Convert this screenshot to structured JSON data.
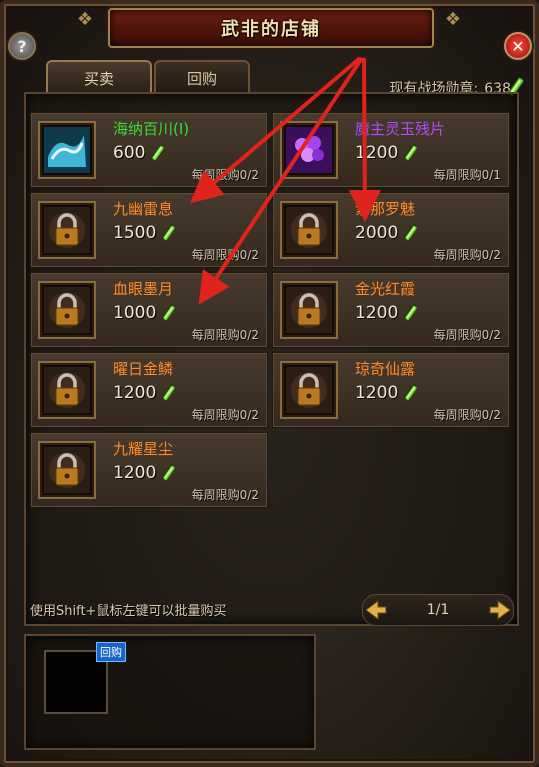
{
  "window": {
    "title": "武非的店铺",
    "help_label": "?",
    "close_label": "✕"
  },
  "tabs": [
    {
      "label": "买卖",
      "active": true
    },
    {
      "label": "回购",
      "active": false
    }
  ],
  "medal": {
    "label": "现有战场勋章:",
    "count": "638",
    "icon": "medal-icon"
  },
  "items": [
    {
      "name": "海纳百川(I)",
      "name_color": "#3fd93a",
      "price": "600",
      "limit": "每周限购0/2",
      "icon": "water-wave-icon",
      "locked": false
    },
    {
      "name": "魔主灵玉残片",
      "name_color": "#b24bff",
      "price": "1200",
      "limit": "每周限购0/1",
      "icon": "purple-jade-icon",
      "locked": false
    },
    {
      "name": "九幽雷息",
      "name_color": "#ff8a2a",
      "price": "1500",
      "limit": "每周限购0/2",
      "icon": "lock-icon",
      "locked": true
    },
    {
      "name": "紫那罗魅",
      "name_color": "#ff8a2a",
      "price": "2000",
      "limit": "每周限购0/2",
      "icon": "lock-icon",
      "locked": true
    },
    {
      "name": "血眼墨月",
      "name_color": "#ff8a2a",
      "price": "1000",
      "limit": "每周限购0/2",
      "icon": "lock-icon",
      "locked": true
    },
    {
      "name": "金光红霞",
      "name_color": "#ff8a2a",
      "price": "1200",
      "limit": "每周限购0/2",
      "icon": "lock-icon",
      "locked": true
    },
    {
      "name": "曜日金鳞",
      "name_color": "#ff8a2a",
      "price": "1200",
      "limit": "每周限购0/2",
      "icon": "lock-icon",
      "locked": true
    },
    {
      "name": "琼奇仙露",
      "name_color": "#ff8a2a",
      "price": "1200",
      "limit": "每周限购0/2",
      "icon": "lock-icon",
      "locked": true
    },
    {
      "name": "九耀星尘",
      "name_color": "#ff8a2a",
      "price": "1200",
      "limit": "每周限购0/2",
      "icon": "lock-icon",
      "locked": true
    }
  ],
  "hint": "使用Shift+鼠标左键可以批量购买",
  "pager": {
    "text": "1/1"
  },
  "buyback": {
    "badge": "回购"
  },
  "colors": {
    "accent_gold": "#b08c50",
    "arrow_red": "#e0231c",
    "name_orange": "#ff8a2a"
  }
}
